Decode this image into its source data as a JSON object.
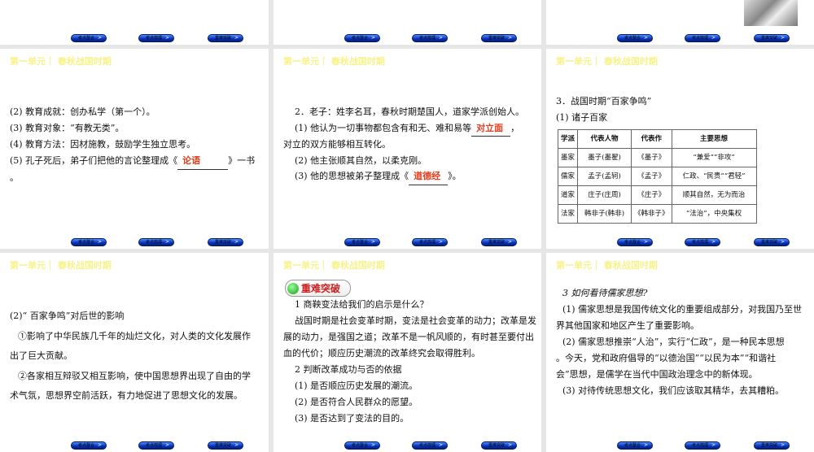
{
  "header": "第一单元｜ 春秋战国时期",
  "nav": [
    "考点整合",
    "考点梳理",
    "重难突破"
  ],
  "s4": {
    "lines": [
      "(2) 教育成就：创办私学（第一个）。",
      "(3) 教育对象：“有教无类”。",
      "(4) 教育方法：因材施教，鼓励学生独立思考。"
    ],
    "l5a": "(5) 孔子死后，弟子们把他的言论整理成《",
    "l5ans": "论语",
    "l5b": "》一书",
    "l6": "。"
  },
  "s5": {
    "l1": "2．老子：姓李名耳，春秋时期楚国人，道家学派创始人。",
    "l2a": "(1) 他认为一切事物都包含有和无、难和易等",
    "l2ans": "对立面",
    "l2b": "，",
    "l3": "对立的双方能够相互转化。",
    "l4": "(2) 他主张顺其自然，以柔克刚。",
    "l5a": "(3) 他的思想被弟子整理成《",
    "l5ans": "道德经",
    "l5b": "》。"
  },
  "s6": {
    "l1": "3．战国时期“百家争鸣”",
    "l2": "(1) 诸子百家",
    "table": {
      "headers": [
        "学派",
        "代表人物",
        "代表作",
        "主要思想"
      ],
      "rows": [
        [
          "墨家",
          "墨子(墨翟)",
          "《墨子》",
          "“兼爱”“非攻”"
        ],
        [
          "儒家",
          "孟子(孟轲)",
          "《孟子》",
          "仁政、“民贵”“君轻”"
        ],
        [
          "道家",
          "庄子(庄周)",
          "《庄子》",
          "顺其自然，无为而治"
        ],
        [
          "法家",
          "韩非子(韩非)",
          "《韩非子》",
          "“法治”，中央集权"
        ]
      ]
    }
  },
  "s7": {
    "lines": [
      "(2)“ 百家争鸣”对后世的影响",
      "①影响了中华民族几千年的灿烂文化，对人类的文化发展作",
      "出了巨大贡献。",
      "②各家相互辩驳又相互影响，使中国思想界出现了自由的学",
      "术气氛，思想界空前活跃，有力地促进了思想文化的发展。"
    ]
  },
  "s8": {
    "badge": "重难突破",
    "lines": [
      "1  商鞅变法给我们的启示是什么？",
      "战国时期是社会变革时期，变法是社会变革的动力；改革是发",
      "展的动力，是强国之道；改革不是一帆风顺的，有时甚至要付出",
      "血的代价；顺应历史潮流的改革终究会取得胜利。",
      "2  判断改革成功与否的依据",
      "(1) 是否顺应历史发展的潮流。",
      "(2) 是否符合人民群众的愿望。",
      "(3) 是否达到了变法的目的。"
    ]
  },
  "s9": {
    "lines": [
      "3  如何看待儒家思想?",
      "(1) 儒家思想是我国传统文化的重要组成部分，对我国乃至世",
      "界其他国家和地区产生了重要影响。",
      "(2) 儒家思想推崇“人治”，实行“仁政”，是一种民本思想",
      "。今天，党和政府倡导的“以德治国”“以民为本”“和谐社",
      "会”思想，是儒学在当代中国政治理念中的新体现。",
      "(3) 对待传统思想文化，我们应该取其精华，去其糟粕。"
    ]
  }
}
